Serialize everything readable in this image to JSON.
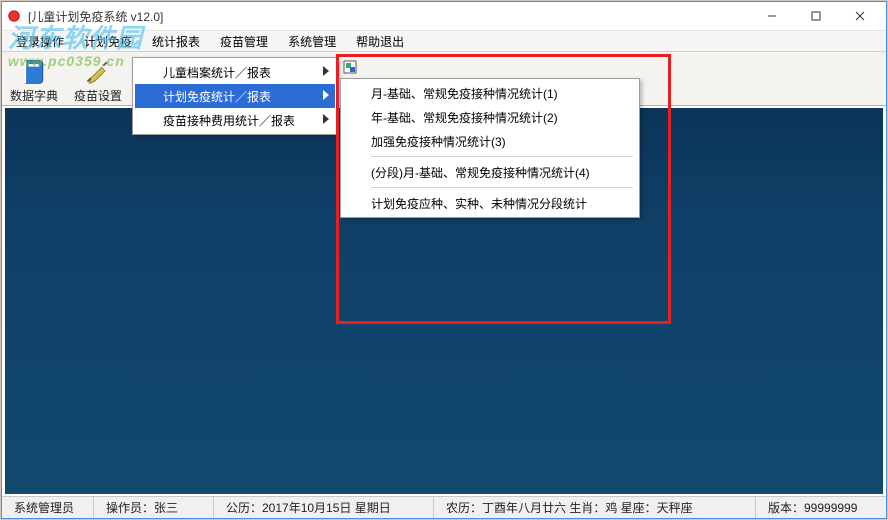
{
  "window": {
    "title": "[儿童计划免疫系统  v12.0]"
  },
  "menubar": {
    "items": [
      "登录操作",
      "计划免疫",
      "统计报表",
      "疫苗管理",
      "系统管理",
      "帮助退出"
    ]
  },
  "toolbar": {
    "btn1": "数据字典",
    "btn2": "疫苗设置"
  },
  "watermark": {
    "line1": "河东软件园",
    "line2": "www.pc0359.cn"
  },
  "dropdown1": {
    "item1": "儿童档案统计／报表",
    "item2": "计划免疫统计／报表",
    "item3": "疫苗接种费用统计／报表"
  },
  "dropdown2": {
    "item1": "月-基础、常规免疫接种情况统计(1)",
    "item2": "年-基础、常规免疫接种情况统计(2)",
    "item3": "加强免疫接种情况统计(3)",
    "item4": "(分段)月-基础、常规免疫接种情况统计(4)",
    "item5": "计划免疫应种、实种、未种情况分段统计"
  },
  "statusbar": {
    "cell1": "系统管理员",
    "cell2": "操作员：张三",
    "cell3": "公历：2017年10月15日  星期日",
    "cell4": "农历：丁酉年八月廿六  生肖：鸡  星座：天秤座",
    "cell5": "版本：99999999"
  }
}
